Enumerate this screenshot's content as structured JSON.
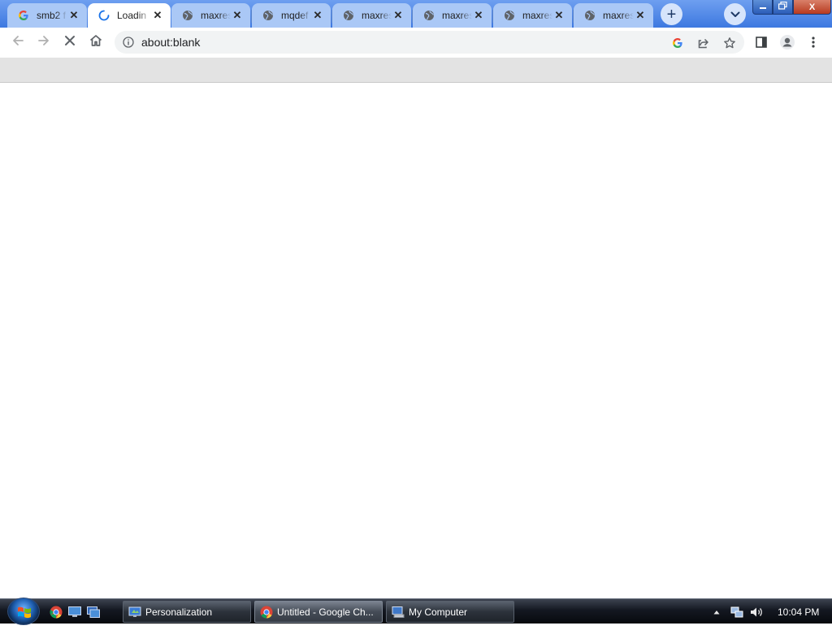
{
  "browser": {
    "tabs": [
      {
        "title": "smb2 f",
        "icon": "google-g-icon",
        "active": false
      },
      {
        "title": "Loadin",
        "icon": "loading-spinner-icon",
        "active": true
      },
      {
        "title": "maxres",
        "icon": "globe-icon",
        "active": false
      },
      {
        "title": "mqdef",
        "icon": "globe-icon",
        "active": false
      },
      {
        "title": "maxres",
        "icon": "globe-icon",
        "active": false
      },
      {
        "title": "maxres",
        "icon": "globe-icon",
        "active": false
      },
      {
        "title": "maxres",
        "icon": "globe-icon",
        "active": false
      },
      {
        "title": "maxres",
        "icon": "globe-icon",
        "active": false
      }
    ],
    "new_tab_label": "+",
    "window_buttons": {
      "close": "X"
    },
    "address_bar": {
      "url": "about:blank"
    },
    "colors": {
      "tabstrip": "#3d78e0",
      "inactive_tab": "#aac8f6",
      "active_tab": "#ffffff"
    }
  },
  "taskbar": {
    "buttons": [
      {
        "label": "Personalization",
        "icon": "personalization-icon",
        "active": false
      },
      {
        "label": "Untitled - Google Ch...",
        "icon": "chrome-icon",
        "active": true
      },
      {
        "label": "My Computer",
        "icon": "my-computer-icon",
        "active": false
      }
    ],
    "clock": "10:04 PM"
  }
}
